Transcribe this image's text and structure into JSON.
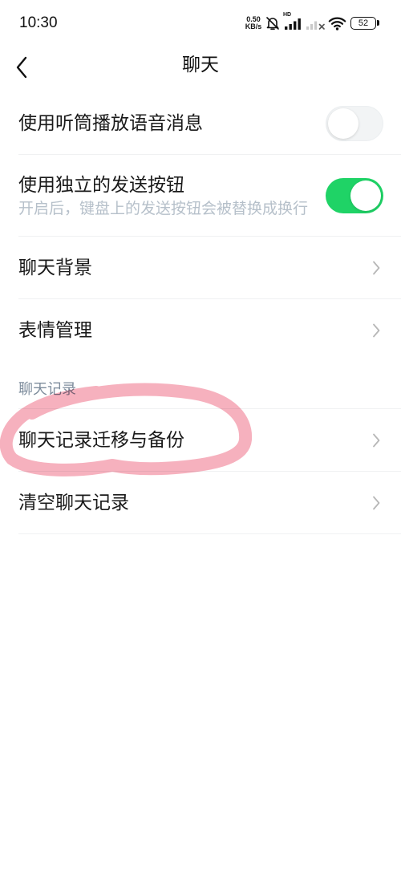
{
  "status_bar": {
    "time": "10:30",
    "net_speed": {
      "value": "0.50",
      "unit": "KB/s"
    },
    "signal_label": "HD",
    "battery_level": "52",
    "icons": {
      "mute": "bell-off-icon",
      "signal": "signal-icon",
      "signal_secondary": "signal-off-icon",
      "wifi": "wifi-icon",
      "battery": "battery-icon"
    }
  },
  "header": {
    "title": "聊天",
    "back_icon": "chevron-left-icon"
  },
  "settings": {
    "earpiece_playback": {
      "label": "使用听筒播放语音消息",
      "enabled": false
    },
    "separate_send_button": {
      "label": "使用独立的发送按钮",
      "description": "开启后，键盘上的发送按钮会被替换成换行",
      "enabled": true
    },
    "chat_background": {
      "label": "聊天背景",
      "icon": "chevron-right-icon"
    },
    "sticker_management": {
      "label": "表情管理",
      "icon": "chevron-right-icon"
    },
    "chat_history": {
      "section_title": "聊天记录",
      "migrate_backup": {
        "label": "聊天记录迁移与备份",
        "icon": "chevron-right-icon"
      },
      "clear_history": {
        "label": "清空聊天记录",
        "icon": "chevron-right-icon"
      }
    }
  },
  "colors": {
    "background": "#ffffff",
    "text_primary": "#1a1a1a",
    "text_description": "#b6c0ca",
    "section_title": "#7d8c9c",
    "toggle_on": "#1fd366",
    "toggle_off": "#f2f4f5",
    "chevron": "#b7b7b7",
    "divider": "#f0f1f2",
    "annotation": "#f4a3b3"
  }
}
